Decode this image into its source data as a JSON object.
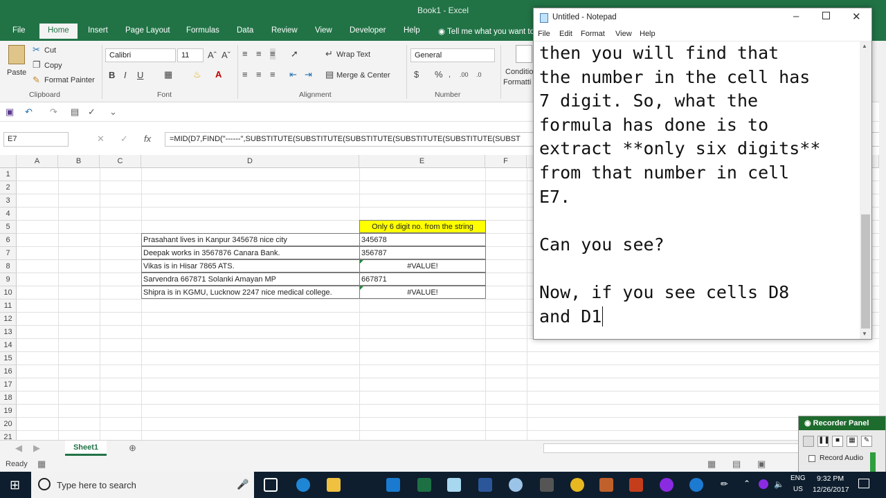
{
  "excel": {
    "window_title": "Book1 - Excel",
    "tabs": [
      "File",
      "Home",
      "Insert",
      "Page Layout",
      "Formulas",
      "Data",
      "Review",
      "View",
      "Developer",
      "Help"
    ],
    "tell_me": "Tell me what you want to",
    "clipboard": {
      "paste": "Paste",
      "cut": "Cut",
      "copy": "Copy",
      "format_painter": "Format Painter",
      "group": "Clipboard"
    },
    "font": {
      "name": "Calibri",
      "size": "11",
      "group": "Font"
    },
    "alignment": {
      "wrap": "Wrap Text",
      "merge": "Merge & Center",
      "group": "Alignment"
    },
    "number": {
      "format": "General",
      "group": "Number",
      "conditional": "Conditio",
      "formatting": "Formatti"
    },
    "name_box": "E7",
    "formula": "=MID(D7,FIND(\"------\",SUBSTITUTE(SUBSTITUTE(SUBSTITUTE(SUBSTITUTE(SUBSTITUTE(SUBST",
    "columns": [
      "A",
      "B",
      "C",
      "D",
      "E",
      "F"
    ],
    "rows": [
      "1",
      "2",
      "3",
      "4",
      "5",
      "6",
      "7",
      "8",
      "9",
      "10",
      "11",
      "12",
      "13",
      "14",
      "15",
      "16",
      "17",
      "18",
      "19",
      "20",
      "21"
    ],
    "header_cell": "Only 6 digit no. from the string",
    "header_color": "#ffff00",
    "table": [
      {
        "d": "Prasahant lives in Kanpur 345678 nice city",
        "e": "345678"
      },
      {
        "d": "Deepak works in 3567876 Canara Bank.",
        "e": "356787"
      },
      {
        "d": "Vikas is in Hisar 7865 ATS.",
        "e": "#VALUE!"
      },
      {
        "d": "Sarvendra 667871 Solanki Amayan MP",
        "e": "667871"
      },
      {
        "d": "Shipra is in KGMU, Lucknow 2247 nice medical college.",
        "e": "#VALUE!"
      }
    ],
    "sheet_tab": "Sheet1",
    "status": "Ready",
    "accent": "#217346"
  },
  "notepad": {
    "title": "Untitled - Notepad",
    "menu": [
      "File",
      "Edit",
      "Format",
      "View",
      "Help"
    ],
    "lines": [
      "then you will find that",
      "the number in the cell has",
      "7 digit. So, what the",
      "formula has done is to",
      "extract **only six digits**",
      "from that number in cell",
      "E7.",
      "",
      "Can you see?",
      "",
      "Now, if you see cells D8",
      "and D1"
    ]
  },
  "recorder": {
    "title": "Recorder Panel",
    "record_audio": "Record Audio"
  },
  "taskbar": {
    "search": "Type here to search",
    "lang": "ENG",
    "region": "US",
    "time": "9:32 PM",
    "date": "12/26/2017"
  }
}
